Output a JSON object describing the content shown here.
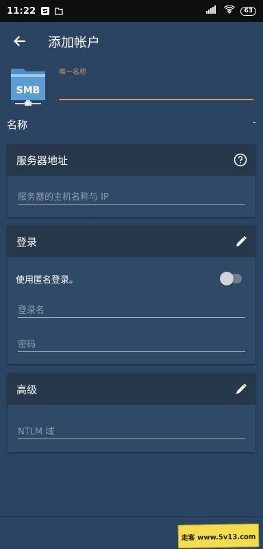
{
  "status_bar": {
    "time": "11:22",
    "battery": "63"
  },
  "appbar": {
    "title": "添加帐户"
  },
  "account": {
    "icon_label": "SMB",
    "name_field_label": "唯一名称",
    "name_field_value": "",
    "name_title": "名称",
    "name_value": "-"
  },
  "server_card": {
    "title": "服务器地址",
    "host_placeholder": "服务器的主机名称与 IP"
  },
  "login_card": {
    "title": "登录",
    "anonymous_label": "使用匿名登录。",
    "anonymous_enabled": false,
    "username_placeholder": "登录名",
    "password_placeholder": "密码"
  },
  "advanced_card": {
    "title": "高级",
    "ntlm_placeholder": "NTLM 域"
  },
  "watermark": {
    "text": "走客 www.5v13.com"
  },
  "colors": {
    "background": "#2b4461",
    "card_header": "#27384b",
    "accent": "#d19a62"
  }
}
